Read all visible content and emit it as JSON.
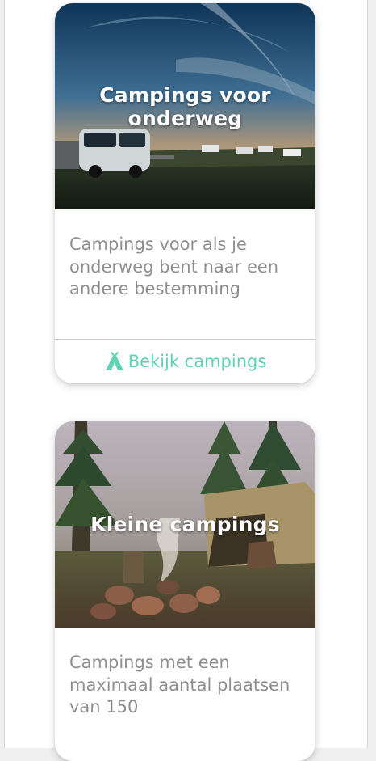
{
  "cards": [
    {
      "title": "Campings voor onderweg",
      "description": "Campings voor als je onderweg bent naar een andere bestemming",
      "cta_label": "Bekijk campings",
      "cta_icon": "tent-icon",
      "image": "campervan-at-sunset-photo"
    },
    {
      "title": "Kleine campings",
      "description": "Campings met een maximaal aantal plaatsen van 150",
      "image": "campfire-tent-forest-photo"
    }
  ],
  "colors": {
    "accent": "#5fd3b6",
    "description_text": "#8f8f8f",
    "divider": "#c8c8c8"
  }
}
